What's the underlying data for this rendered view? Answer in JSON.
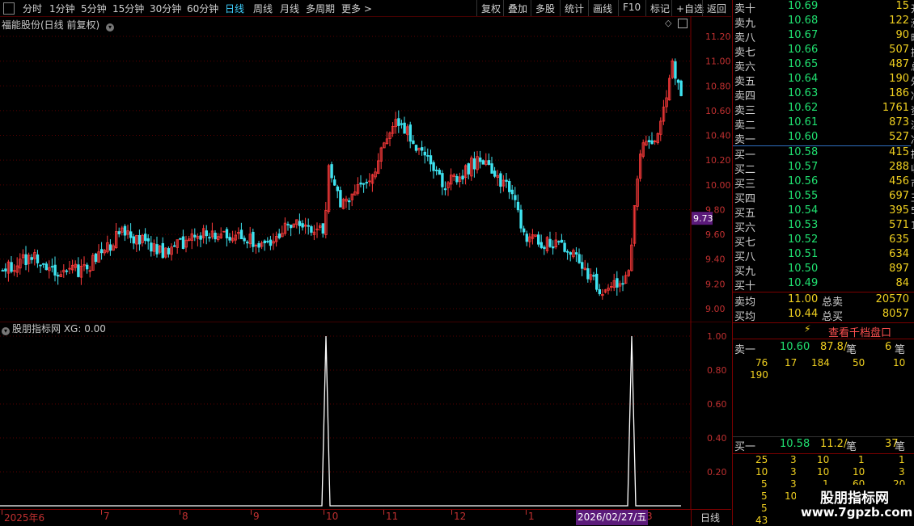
{
  "toolbar": {
    "left_items": [
      "分时",
      "1分钟",
      "5分钟",
      "15分钟",
      "30分钟",
      "60分钟",
      "日线",
      "周线",
      "月线",
      "多周期",
      "更多 >"
    ],
    "active_item": "日线",
    "right_items": [
      "复权",
      "叠加",
      "多股",
      "统计",
      "画线",
      "F10",
      "标记",
      "+自选",
      "返回"
    ]
  },
  "main_chart": {
    "title": "福能股份(日线 前复权)",
    "price_ticks": [
      "11.20",
      "11.00",
      "10.80",
      "10.60",
      "10.40",
      "10.20",
      "10.00",
      "9.80",
      "9.60",
      "9.40",
      "9.20",
      "9.00"
    ],
    "current_price": "9.73"
  },
  "indicator": {
    "title": "股朋指标网 XG: 0.00",
    "ticks": [
      "1.00",
      "0.80",
      "0.60",
      "0.40",
      "0.20"
    ]
  },
  "date_axis": {
    "labels": [
      "2025年6",
      "7",
      "8",
      "9",
      "10",
      "11",
      "12",
      "1",
      "3"
    ],
    "cursor_date": "2026/02/27/五",
    "period": "日线"
  },
  "order_book": {
    "asks": [
      {
        "label": "卖十",
        "price": "10.69",
        "vol": "15"
      },
      {
        "label": "卖九",
        "price": "10.68",
        "vol": "122"
      },
      {
        "label": "卖八",
        "price": "10.67",
        "vol": "90"
      },
      {
        "label": "卖七",
        "price": "10.66",
        "vol": "507"
      },
      {
        "label": "卖六",
        "price": "10.65",
        "vol": "487"
      },
      {
        "label": "卖五",
        "price": "10.64",
        "vol": "190"
      },
      {
        "label": "卖四",
        "price": "10.63",
        "vol": "186"
      },
      {
        "label": "卖三",
        "price": "10.62",
        "vol": "1761"
      },
      {
        "label": "卖二",
        "price": "10.61",
        "vol": "873"
      },
      {
        "label": "卖一",
        "price": "10.60",
        "vol": "527"
      }
    ],
    "bids": [
      {
        "label": "买一",
        "price": "10.58",
        "vol": "415"
      },
      {
        "label": "买二",
        "price": "10.57",
        "vol": "288"
      },
      {
        "label": "买三",
        "price": "10.56",
        "vol": "456"
      },
      {
        "label": "买四",
        "price": "10.55",
        "vol": "697"
      },
      {
        "label": "买五",
        "price": "10.54",
        "vol": "395"
      },
      {
        "label": "买六",
        "price": "10.53",
        "vol": "571"
      },
      {
        "label": "买七",
        "price": "10.52",
        "vol": "635"
      },
      {
        "label": "买八",
        "price": "10.51",
        "vol": "634"
      },
      {
        "label": "买九",
        "price": "10.50",
        "vol": "897"
      },
      {
        "label": "买十",
        "price": "10.49",
        "vol": "84"
      }
    ],
    "sell_avg": {
      "label": "卖均",
      "price": "11.00",
      "total_label": "总卖",
      "total": "20570"
    },
    "buy_avg": {
      "label": "买均",
      "price": "10.44",
      "total_label": "总买",
      "total": "8057"
    },
    "depth_link": "查看千档盘口",
    "sell_queue": {
      "label": "卖一",
      "price": "10.60",
      "avg": "87.8/",
      "unit": "笔",
      "count": "6",
      "count_unit": "笔",
      "rows": [
        [
          "76",
          "17",
          "184",
          "50",
          "10"
        ],
        [
          "190",
          "",
          "",
          "",
          ""
        ]
      ]
    },
    "buy_queue": {
      "label": "买一",
      "price": "10.58",
      "avg": "11.2/",
      "unit": "笔",
      "count": "37",
      "count_unit": "笔",
      "rows": [
        [
          "25",
          "3",
          "10",
          "1",
          "1"
        ],
        [
          "10",
          "3",
          "10",
          "10",
          "3"
        ],
        [
          "5",
          "3",
          "1",
          "60",
          "20"
        ],
        [
          "5",
          "10",
          "",
          "",
          ""
        ],
        [
          "5",
          "",
          "",
          "",
          ""
        ],
        [
          "43",
          "",
          "",
          "",
          ""
        ]
      ]
    },
    "side_strip": [
      "开",
      "涨",
      "昨",
      "换",
      "总",
      "外",
      "净",
      "资",
      "流",
      "净",
      "换",
      "收",
      "市",
      "王",
      "5",
      "1"
    ]
  },
  "watermark": {
    "name": "股朋指标网",
    "url": "www.7gpzb.com"
  },
  "colors": {
    "up": "#ff3b3b",
    "down": "#3fe3f0",
    "ask_price": "#20e070",
    "vol": "#f0d020",
    "axis_red": "#c03030",
    "frame": "#7a0000"
  }
}
